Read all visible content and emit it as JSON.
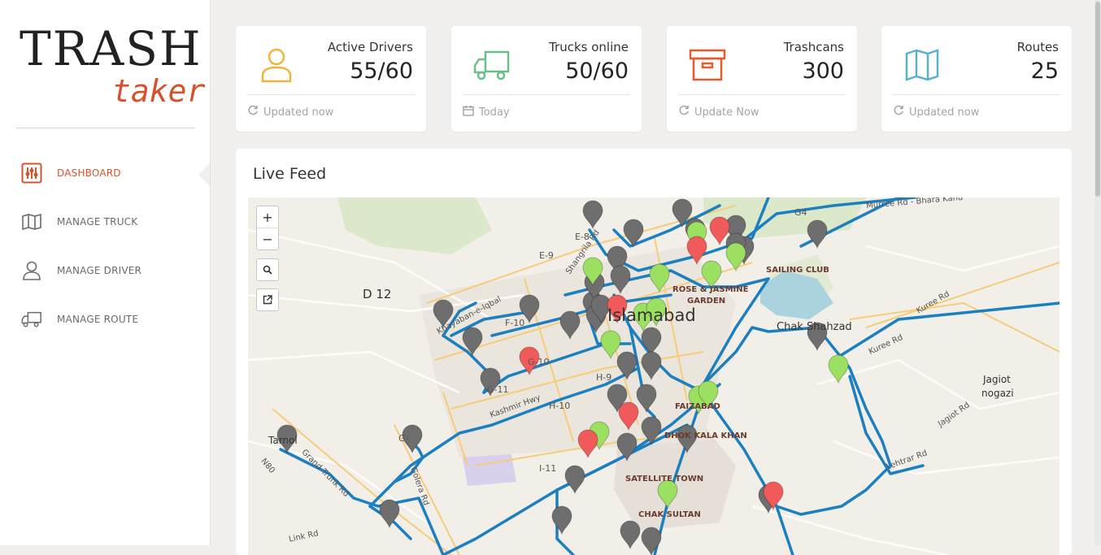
{
  "brand": {
    "line1": "TRASH",
    "line2": "taker"
  },
  "colors": {
    "accent": "#d2532c",
    "drivers": "#f0b43c",
    "trucks": "#6bbf8a",
    "trashcans": "#e85a2a",
    "routes": "#5ab1c9",
    "route_line": "#1c7fc0",
    "pin_gray": "#6e6e6e",
    "pin_green": "#9be060",
    "pin_red": "#f05a5a"
  },
  "sidebar": {
    "items": [
      {
        "label": "DASHBOARD",
        "icon": "sliders-icon",
        "active": true
      },
      {
        "label": "MANAGE TRUCK",
        "icon": "map-icon"
      },
      {
        "label": "MANAGE DRIVER",
        "icon": "user-icon"
      },
      {
        "label": "MANAGE ROUTE",
        "icon": "truck-icon"
      }
    ]
  },
  "stats": [
    {
      "title": "Active Drivers",
      "value": "55/60",
      "footer": "Updated now",
      "icon": "user-icon",
      "footer_icon": "refresh-icon"
    },
    {
      "title": "Trucks online",
      "value": "50/60",
      "footer": "Today",
      "icon": "truck-icon",
      "footer_icon": "calendar-icon"
    },
    {
      "title": "Trashcans",
      "value": "300",
      "footer": "Update Now",
      "icon": "archive-icon",
      "footer_icon": "refresh-icon"
    },
    {
      "title": "Routes",
      "value": "25",
      "footer": "Updated now",
      "icon": "map-icon",
      "footer_icon": "refresh-icon"
    }
  ],
  "feed": {
    "title": "Live Feed",
    "zoom_in": "+",
    "zoom_out": "−",
    "labels": {
      "e8": "E-8",
      "e9": "E-9",
      "d12": "D 12",
      "f10": "F-10",
      "g10": "G-10",
      "g11": "G-11",
      "h9": "H-9",
      "h10": "H-10",
      "i11": "I-11",
      "g": "G-",
      "city": "Islamabad",
      "rose": "ROSE & JASMINE",
      "garden": "GARDEN",
      "sailing": "SAILING CLUB",
      "g4": "G4",
      "chak": "Chak Shahzad",
      "jagiot": "Jagiot",
      "nogazi": "nogazi",
      "faizabad": "FAIZABAD",
      "dhok": "DHOK KALA KHAN",
      "satellite": "SATELLITE TOWN",
      "chaksultan": "CHAK SULTAN",
      "tarnol": "Tarnol",
      "shangrila": "Shangrila Rd",
      "khayaban": "Khayaban-e-Iqbal",
      "kashmir": "Kashmir Hwy",
      "kuree": "Kuree Rd",
      "kuree2": "Kuree Rd",
      "jagiotrd": "Jagiot Rd",
      "bhara": "Murree Rd - Bhara Kahu",
      "golera": "Golera Rd",
      "gtroad": "Grand Trunk Rd",
      "n80": "N80",
      "linkrd": "Link Rd",
      "lehtrar": "Lehtrar Rd"
    }
  }
}
